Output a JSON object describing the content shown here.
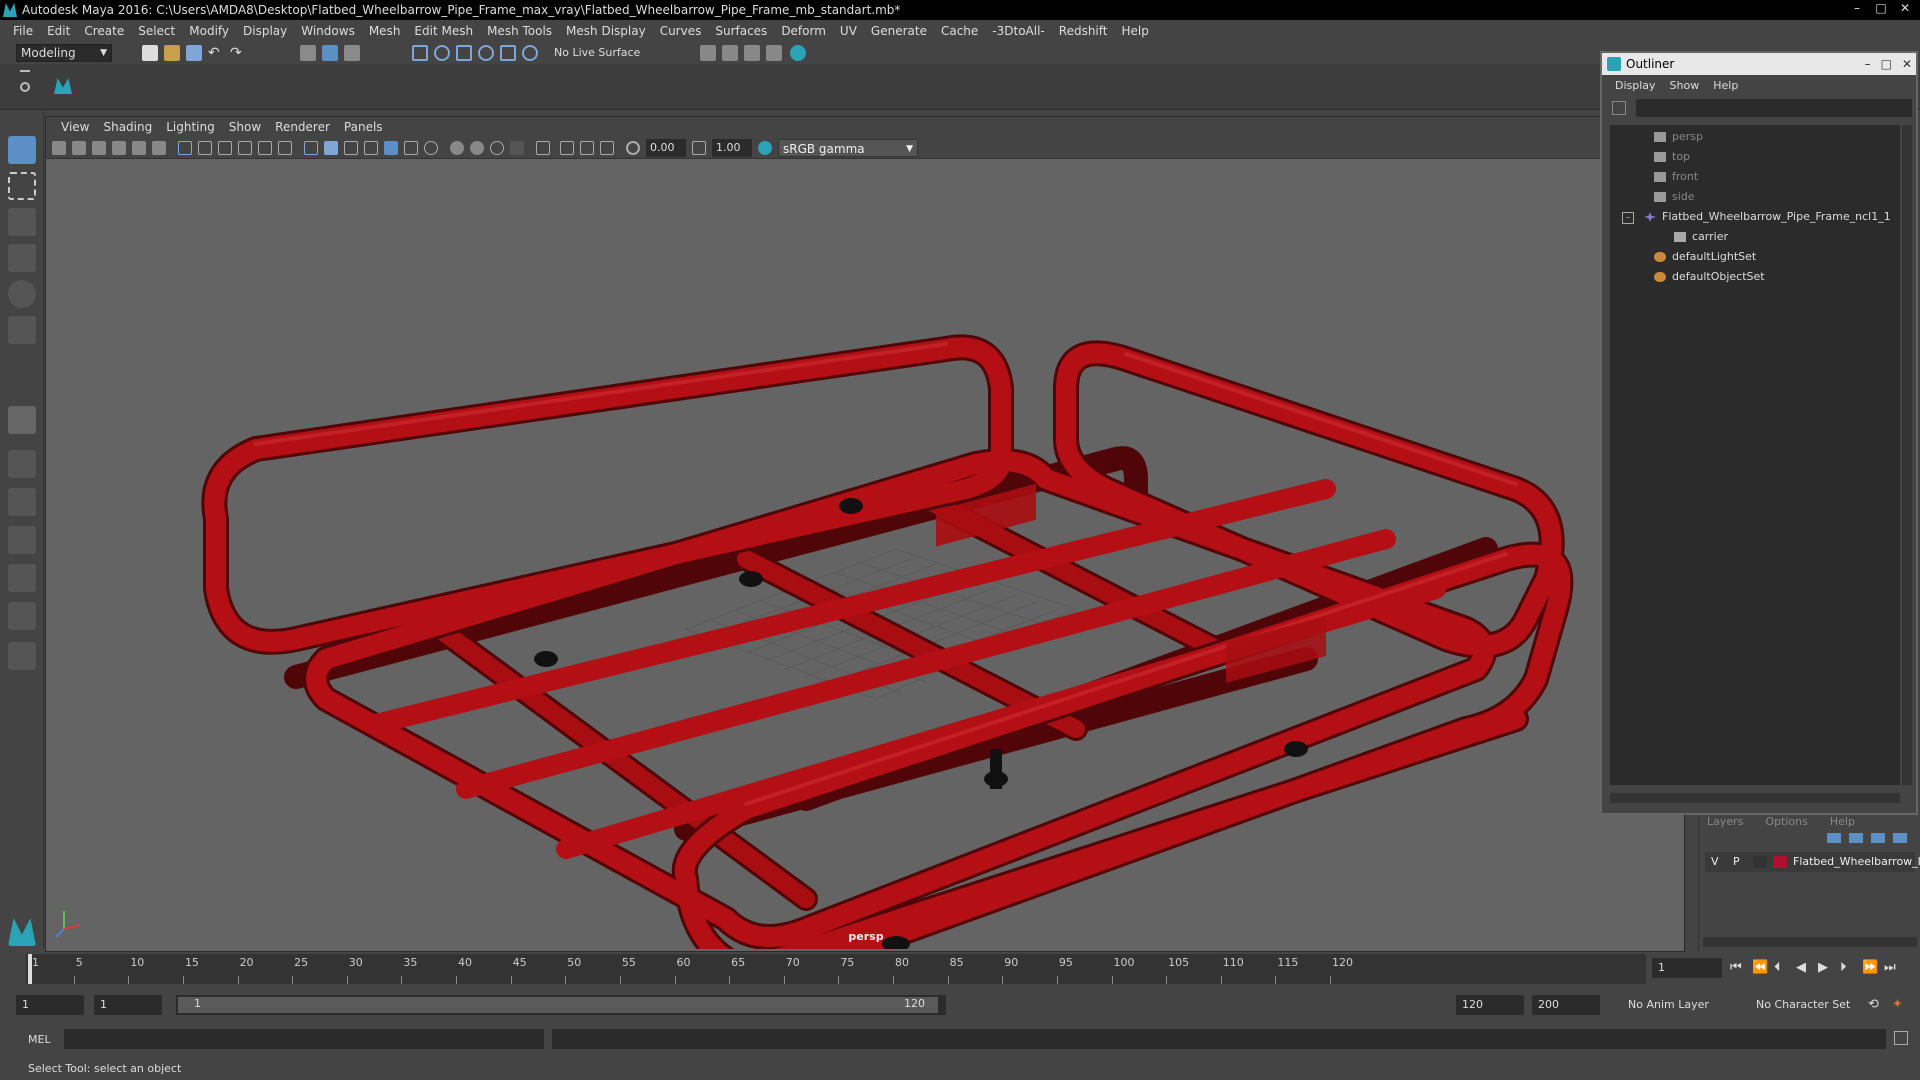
{
  "app": {
    "title": "Autodesk Maya 2016: C:\\Users\\AMDA8\\Desktop\\Flatbed_Wheelbarrow_Pipe_Frame_max_vray\\Flatbed_Wheelbarrow_Pipe_Frame_mb_standart.mb*",
    "window_controls": [
      "–",
      "□",
      "✕"
    ]
  },
  "menubar": [
    "File",
    "Edit",
    "Create",
    "Select",
    "Modify",
    "Display",
    "Windows",
    "Mesh",
    "Edit Mesh",
    "Mesh Tools",
    "Mesh Display",
    "Curves",
    "Surfaces",
    "Deform",
    "UV",
    "Generate",
    "Cache",
    "-3DtoAll-",
    "Redshift",
    "Help"
  ],
  "shelf": {
    "mode": "Modeling",
    "live_surface": "No Live Surface"
  },
  "viewport": {
    "menu": [
      "View",
      "Shading",
      "Lighting",
      "Show",
      "Renderer",
      "Panels"
    ],
    "exposure": "0.00",
    "gamma": "1.00",
    "colorspace": "sRGB gamma",
    "camera": "persp"
  },
  "outliner": {
    "title": "Outliner",
    "menu": [
      "Display",
      "Show",
      "Help"
    ],
    "items": [
      {
        "label": "persp",
        "type": "camera",
        "dim": true
      },
      {
        "label": "top",
        "type": "camera",
        "dim": true
      },
      {
        "label": "front",
        "type": "camera",
        "dim": true
      },
      {
        "label": "side",
        "type": "camera",
        "dim": true
      },
      {
        "label": "Flatbed_Wheelbarrow_Pipe_Frame_ncl1_1",
        "type": "group",
        "dim": false
      },
      {
        "label": "carrier",
        "type": "mesh",
        "dim": false
      },
      {
        "label": "defaultLightSet",
        "type": "set",
        "dim": false
      },
      {
        "label": "defaultObjectSet",
        "type": "set",
        "dim": false
      }
    ]
  },
  "layers": {
    "tabs": [
      "Layers",
      "Options",
      "Help"
    ],
    "row": {
      "v": "V",
      "p": "P",
      "name": "Flatbed_Wheelbarrow_I",
      "color": "#b01030"
    }
  },
  "timeline": {
    "ticks": [
      1,
      5,
      10,
      15,
      20,
      25,
      30,
      35,
      40,
      45,
      50,
      55,
      60,
      65,
      70,
      75,
      80,
      85,
      90,
      95,
      100,
      105,
      110,
      115,
      120
    ],
    "current_frame": "1"
  },
  "range": {
    "start": "1",
    "start2": "1",
    "slider_start": "1",
    "slider_end": "120",
    "end": "120",
    "end2": "200",
    "anim_layer": "No Anim Layer",
    "char_set": "No Character Set"
  },
  "cmdline": {
    "label": "MEL"
  },
  "helpline": {
    "text": "Select Tool: select an object"
  },
  "colors": {
    "frame": "#a80d12",
    "accent": "#2aa3b7"
  }
}
